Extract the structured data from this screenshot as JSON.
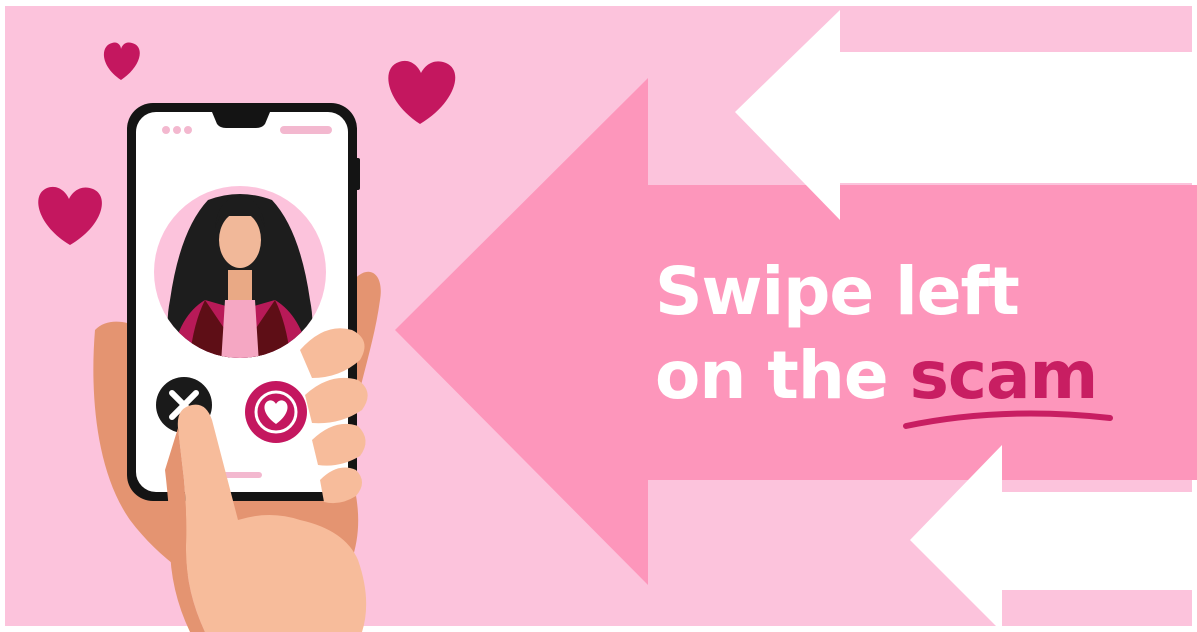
{
  "headline": {
    "line1": "Swipe left",
    "line2_prefix": "on the ",
    "line2_accent": "scam"
  },
  "colors": {
    "background": "#fcc3dc",
    "arrow_pink": "#fd96bb",
    "arrow_white": "#ffffff",
    "heart": "#c4175f",
    "accent_text": "#c81e62",
    "phone_frame": "#141414",
    "skin": "#f7bc9b",
    "skin_shadow": "#e49471",
    "hair": "#1d1d1d",
    "jacket": "#b81a58"
  },
  "icons": [
    "heart-icon",
    "reject-x-icon",
    "like-heart-icon",
    "profile-avatar",
    "hand-icon"
  ]
}
